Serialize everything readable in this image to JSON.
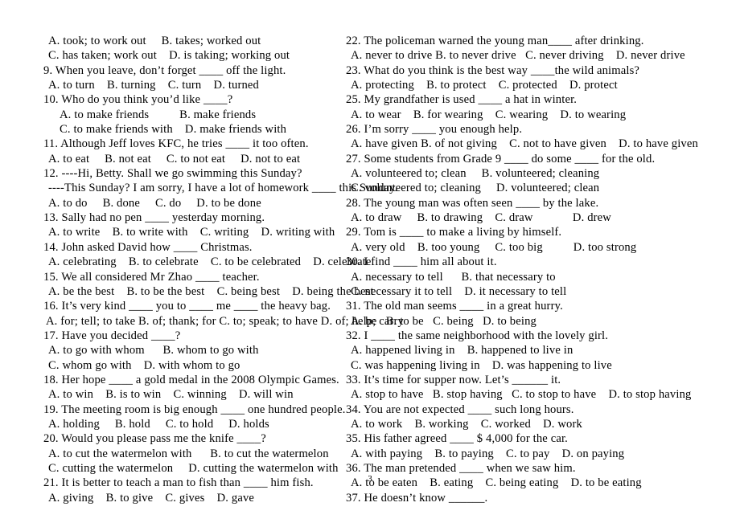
{
  "document": {
    "type": "worksheet",
    "page_number": "3",
    "columns": {
      "left": [
        {
          "indent": 1,
          "text": "A. took; to work out     B. takes; worked out"
        },
        {
          "indent": 1,
          "text": "C. has taken; work out    D. is taking; working out"
        },
        {
          "indent": 0,
          "text": "9. When you leave, don’t forget ____ off the light."
        },
        {
          "indent": 1,
          "text": "A. to turn    B. turning    C. turn    D. turned"
        },
        {
          "indent": 0,
          "text": "10. Who do you think you’d like ____?"
        },
        {
          "indent": 3,
          "text": "A. to make friends          B. make friends"
        },
        {
          "indent": 3,
          "text": "C. to make friends with    D. make friends with"
        },
        {
          "indent": 0,
          "text": "11. Although Jeff loves KFC, he tries ____ it too often."
        },
        {
          "indent": 1,
          "text": "A. to eat     B. not eat     C. to not eat     D. not to eat"
        },
        {
          "indent": 0,
          "text": "12. ----Hi, Betty. Shall we go swimming this Sunday?"
        },
        {
          "indent": 1,
          "text": "----This Sunday? I am sorry, I have a lot of homework ____ this Sunday."
        },
        {
          "indent": 1,
          "text": "A. to do     B. done     C. do     D. to be done"
        },
        {
          "indent": 0,
          "text": "13. Sally had no pen ____ yesterday morning."
        },
        {
          "indent": 1,
          "text": "A. to write    B. to write with    C. writing    D. writing with"
        },
        {
          "indent": 0,
          "text": "14. John asked David how ____ Christmas."
        },
        {
          "indent": 1,
          "text": "A. celebrating    B. to celebrate    C. to be celebrated    D. celebrate"
        },
        {
          "indent": 0,
          "text": "15. We all considered Mr Zhao ____ teacher."
        },
        {
          "indent": 1,
          "text": "A. be the best    B. to be the best    C. being best    D. being the best"
        },
        {
          "indent": 0,
          "text": "16. It’s very kind ____ you to ____ me ____ the heavy bag."
        },
        {
          "indent": 0,
          "text": " A. for; tell; to take B. of; thank; for C. to; speak; to have D. of; help; carry"
        },
        {
          "indent": 0,
          "text": "17. Have you decided ____?"
        },
        {
          "indent": 1,
          "text": "A. to go with whom      B. whom to go with"
        },
        {
          "indent": 1,
          "text": "C. whom go with    D. with whom to go"
        },
        {
          "indent": 0,
          "text": "18. Her hope ____ a gold medal in the 2008 Olympic Games."
        },
        {
          "indent": 1,
          "text": "A. to win    B. is to win    C. winning    D. will win"
        },
        {
          "indent": 0,
          "text": "19. The meeting room is big enough ____ one hundred people."
        },
        {
          "indent": 1,
          "text": "A. holding     B. hold     C. to hold     D. holds"
        },
        {
          "indent": 0,
          "text": "20. Would you please pass me the knife ____?"
        },
        {
          "indent": 1,
          "text": "A. to cut the watermelon with      B. to cut the watermelon"
        },
        {
          "indent": 1,
          "text": "C. cutting the watermelon     D. cutting the watermelon with"
        },
        {
          "indent": 0,
          "text": "21. It is better to teach a man to fish than ____ him fish."
        },
        {
          "indent": 1,
          "text": "A. giving    B. to give    C. gives    D. gave"
        }
      ],
      "right": [
        {
          "indent": 0,
          "text": "22. The policeman warned the young man____ after drinking."
        },
        {
          "indent": 1,
          "text": "A. never to drive B. to never drive   C. never driving    D. never drive"
        },
        {
          "indent": 0,
          "text": "23. What do you think is the best way ____the wild animals?"
        },
        {
          "indent": 1,
          "text": "A. protecting    B. to protect    C. protected    D. protect"
        },
        {
          "indent": 0,
          "text": "25. My grandfather is used ____ a hat in winter."
        },
        {
          "indent": 1,
          "text": "A. to wear    B. for wearing    C. wearing    D. to wearing"
        },
        {
          "indent": 0,
          "text": "26. I’m sorry ____ you enough help."
        },
        {
          "indent": 1,
          "text": "A. have given B. of not giving    C. not to have given    D. to have given"
        },
        {
          "indent": 0,
          "text": "27. Some students from Grade 9 ____ do some ____ for the old."
        },
        {
          "indent": 1,
          "text": "A. volunteered to; clean     B. volunteered; cleaning"
        },
        {
          "indent": 1,
          "text": "C. volunteered to; cleaning     D. volunteered; clean"
        },
        {
          "indent": 0,
          "text": "28. The young man was often seen ____ by the lake."
        },
        {
          "indent": 1,
          "text": "A. to draw     B. to drawing    C. draw             D. drew"
        },
        {
          "indent": 0,
          "text": "29. Tom is ____ to make a living by himself."
        },
        {
          "indent": 1,
          "text": "A. very old    B. too young     C. too big          D. too strong"
        },
        {
          "indent": 0,
          "text": "30. I find ____ him all about it."
        },
        {
          "indent": 1,
          "text": "A. necessary to tell      B. that necessary to"
        },
        {
          "indent": 1,
          "text": "C. necessary it to tell    D. it necessary to tell"
        },
        {
          "indent": 0,
          "text": "31. The old man seems ____ in a great hurry."
        },
        {
          "indent": 1,
          "text": "A. be   B. to be   C. being   D. to being"
        },
        {
          "indent": 0,
          "text": "32. I ____ the same neighborhood with the lovely girl."
        },
        {
          "indent": 1,
          "text": "A. happened living in    B. happened to live in"
        },
        {
          "indent": 1,
          "text": "C. was happening living in    D. was happening to live"
        },
        {
          "indent": 0,
          "text": "33. It’s time for supper now. Let’s ______ it."
        },
        {
          "indent": 1,
          "text": "A. stop to have   B. stop having   C. to stop to have    D. to stop having"
        },
        {
          "indent": 0,
          "text": "34. You are not expected ____ such long hours."
        },
        {
          "indent": 1,
          "text": "A. to work    B. working    C. worked    D. work"
        },
        {
          "indent": 0,
          "text": "35. His father agreed ____ $ 4,000 for the car."
        },
        {
          "indent": 1,
          "text": "A. with paying    B. to paying    C. to pay    D. on paying"
        },
        {
          "indent": 0,
          "text": "36. The man pretended ____ when we saw him."
        },
        {
          "indent": 1,
          "text": "A. to be eaten    B. eating    C. being eating    D. to be eating"
        },
        {
          "indent": 0,
          "text": "37. He doesn’t know ______."
        }
      ]
    }
  }
}
